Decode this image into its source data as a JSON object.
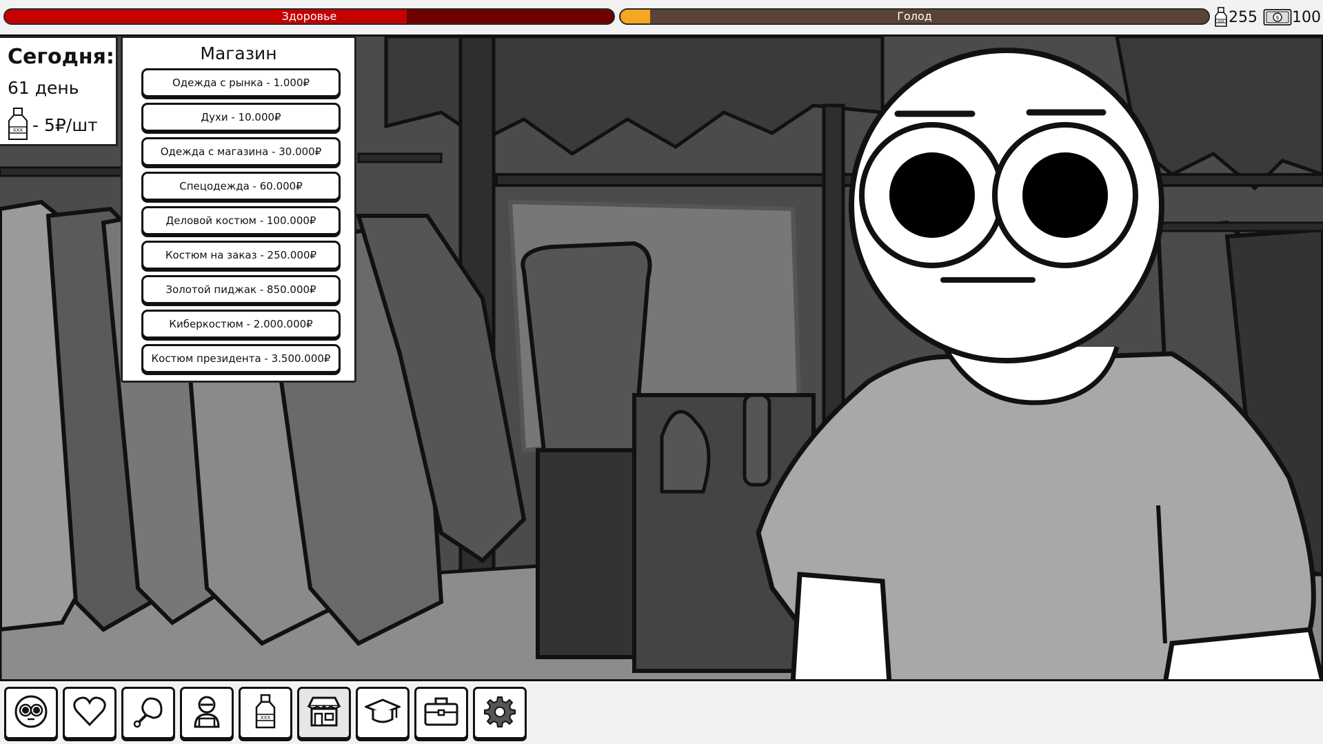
{
  "status": {
    "health_label": "Здоровье",
    "health_fraction": 0.66,
    "hunger_label": "Голод",
    "hunger_fraction": 0.05,
    "bottles_count": "255",
    "money_count": "100"
  },
  "info": {
    "today_label": "Сегодня:",
    "day_text": "61 день",
    "bottle_price": "- 5₽/шт"
  },
  "shop": {
    "title": "Магазин",
    "items": [
      "Одежда с рынка - 1.000₽",
      "Духи - 10.000₽",
      "Одежда с магазина - 30.000₽",
      "Спецодежда - 60.000₽",
      "Деловой костюм - 100.000₽",
      "Костюм на заказ - 250.000₽",
      "Золотой пиджак - 850.000₽",
      "Киберкостюм - 2.000.000₽",
      "Костюм президента - 3.500.000₽"
    ]
  },
  "toolbar": {
    "icons": [
      "face-icon",
      "heart-icon",
      "meat-icon",
      "hacker-icon",
      "bottle-icon",
      "shop-icon",
      "graduation-cap-icon",
      "briefcase-icon",
      "gear-icon"
    ],
    "active": "shop-icon"
  },
  "colors": {
    "health_fill": "#c40000",
    "health_bg": "#6e0000",
    "hunger_fill": "#f5a623",
    "hunger_bg": "#5b4436"
  }
}
